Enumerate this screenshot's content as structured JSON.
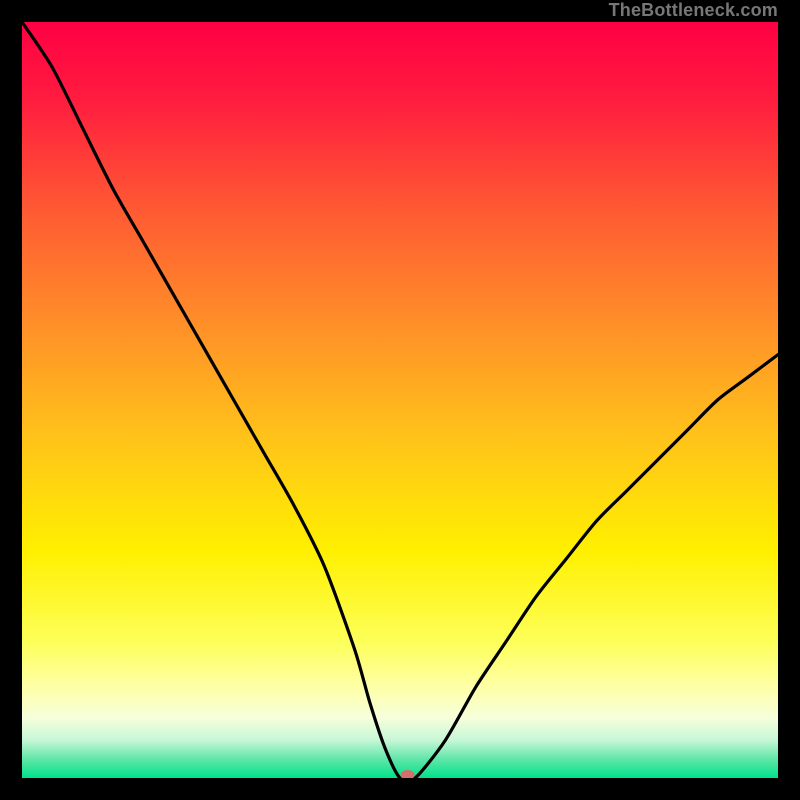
{
  "watermark": "TheBottleneck.com",
  "chart_data": {
    "type": "line",
    "title": "",
    "xlabel": "",
    "ylabel": "",
    "xlim": [
      0,
      100
    ],
    "ylim": [
      0,
      100
    ],
    "background_gradient": {
      "stops": [
        {
          "pos": 0.0,
          "color": "#ff0043"
        },
        {
          "pos": 0.1,
          "color": "#ff1b3f"
        },
        {
          "pos": 0.25,
          "color": "#ff5a33"
        },
        {
          "pos": 0.4,
          "color": "#ff8f28"
        },
        {
          "pos": 0.55,
          "color": "#ffc31a"
        },
        {
          "pos": 0.7,
          "color": "#fff000"
        },
        {
          "pos": 0.82,
          "color": "#fdff59"
        },
        {
          "pos": 0.88,
          "color": "#feffa7"
        },
        {
          "pos": 0.92,
          "color": "#f7ffdb"
        },
        {
          "pos": 0.95,
          "color": "#c6f7d6"
        },
        {
          "pos": 0.975,
          "color": "#60e6a8"
        },
        {
          "pos": 1.0,
          "color": "#00e28a"
        }
      ]
    },
    "x": [
      0,
      4,
      8,
      12,
      16,
      20,
      24,
      28,
      32,
      36,
      40,
      44,
      46,
      48,
      50,
      52,
      56,
      60,
      64,
      68,
      72,
      76,
      80,
      84,
      88,
      92,
      96,
      100
    ],
    "values": [
      100,
      94,
      86,
      78,
      71,
      64,
      57,
      50,
      43,
      36,
      28,
      17,
      10,
      4,
      0,
      0,
      5,
      12,
      18,
      24,
      29,
      34,
      38,
      42,
      46,
      50,
      53,
      56
    ],
    "marker": {
      "x": 51,
      "y": 0,
      "color": "#d46f6b"
    },
    "curve_color": "#000000",
    "frame_color": "#000000"
  }
}
